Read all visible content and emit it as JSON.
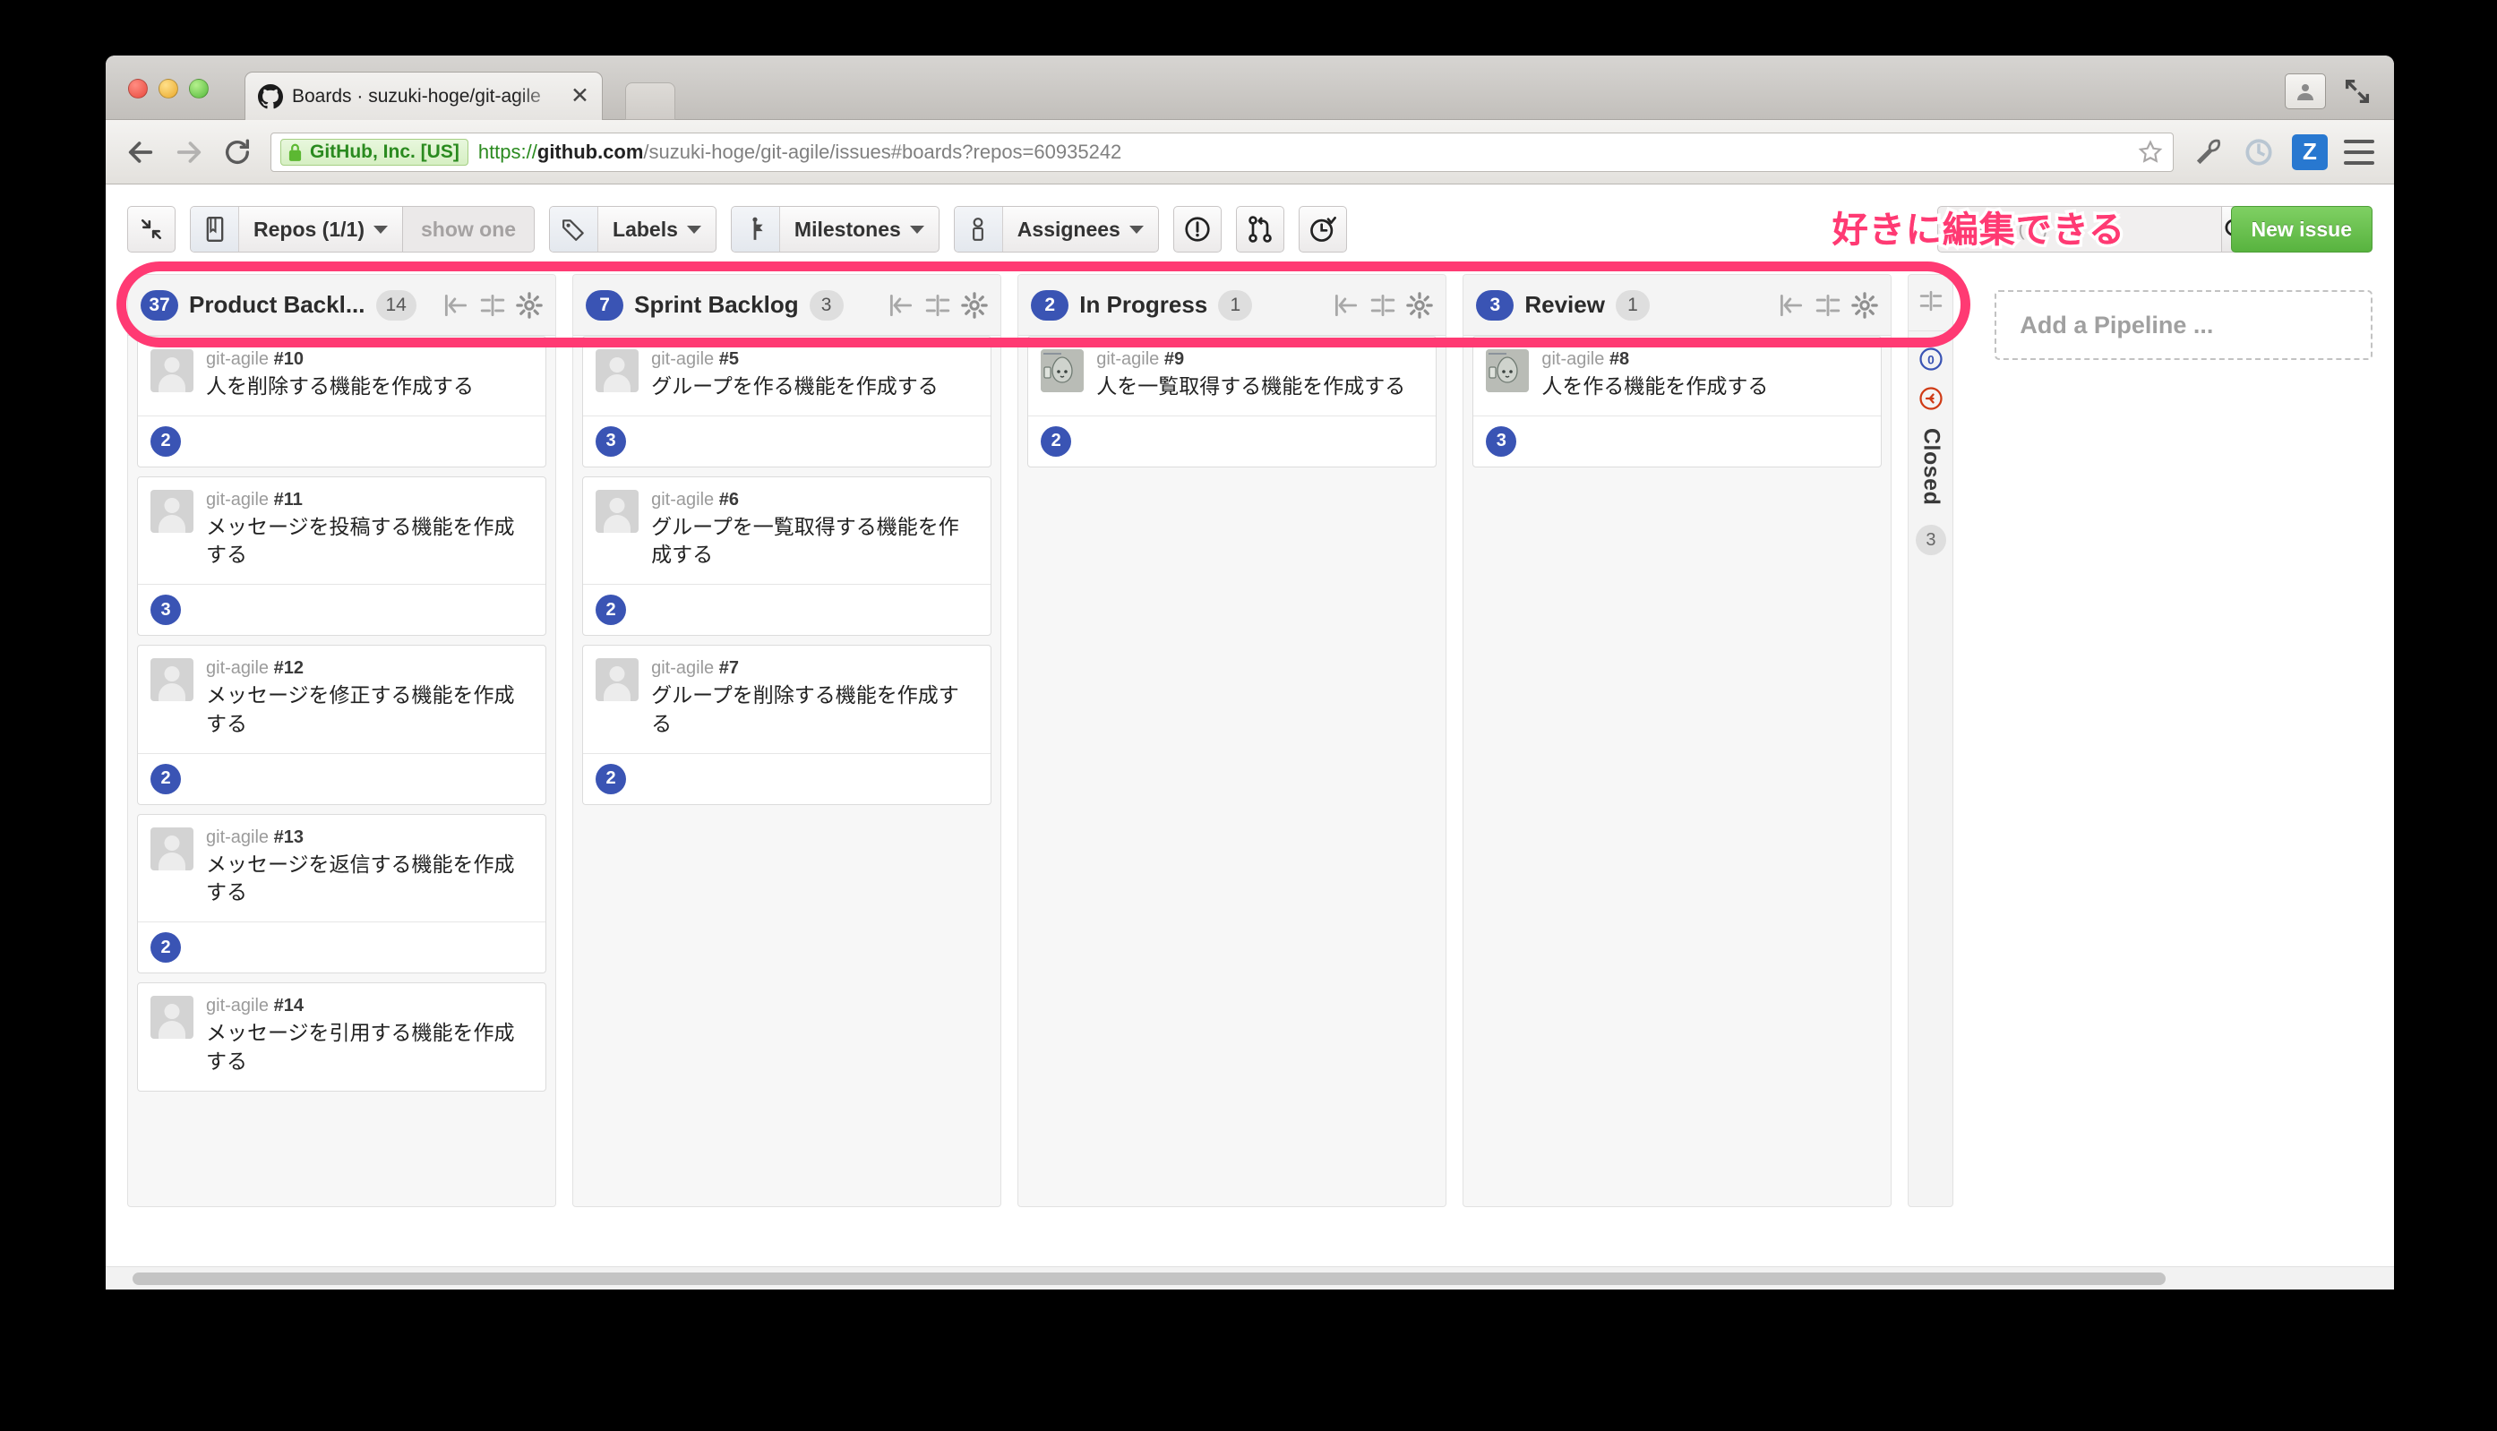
{
  "browser": {
    "tab_title": "Boards · suzuki-hoge/git-agile",
    "tab_close_label": "✕",
    "ssl_label": "GitHub, Inc. [US]",
    "url_scheme": "https://",
    "url_host": "github.com",
    "url_path": "/suzuki-hoge/git-agile/issues#boards?repos=60935242",
    "extension_badge": "Z"
  },
  "toolbar": {
    "collapse_all_label": "collapse-all",
    "repos_label": "Repos (1/1)",
    "show_one_label": "show one",
    "labels_label": "Labels",
    "milestones_label": "Milestones",
    "assignees_label": "Assignees",
    "issues_filter_label": "issues",
    "pulls_filter_label": "pull-requests",
    "recent_filter_label": "recently-updated",
    "search_placeholder": "Search ( / )",
    "new_issue_label": "New issue"
  },
  "annotation": {
    "text": "好きに編集できる",
    "color": "#ff3a73"
  },
  "board": {
    "pipelines": [
      {
        "badge": "37",
        "title": "Product Backl...",
        "count": "14",
        "cards": [
          {
            "repo": "git-agile",
            "number": "#10",
            "title": "人を削除する機能を作成する",
            "estimate": "2",
            "avatar": "placeholder"
          },
          {
            "repo": "git-agile",
            "number": "#11",
            "title": "メッセージを投稿する機能を作成する",
            "estimate": "3",
            "avatar": "placeholder"
          },
          {
            "repo": "git-agile",
            "number": "#12",
            "title": "メッセージを修正する機能を作成する",
            "estimate": "2",
            "avatar": "placeholder"
          },
          {
            "repo": "git-agile",
            "number": "#13",
            "title": "メッセージを返信する機能を作成する",
            "estimate": "2",
            "avatar": "placeholder"
          },
          {
            "repo": "git-agile",
            "number": "#14",
            "title": "メッセージを引用する機能を作成する",
            "estimate": "",
            "avatar": "placeholder"
          }
        ]
      },
      {
        "badge": "7",
        "title": "Sprint Backlog",
        "count": "3",
        "cards": [
          {
            "repo": "git-agile",
            "number": "#5",
            "title": "グループを作る機能を作成する",
            "estimate": "3",
            "avatar": "placeholder"
          },
          {
            "repo": "git-agile",
            "number": "#6",
            "title": "グループを一覧取得する機能を作成する",
            "estimate": "2",
            "avatar": "placeholder"
          },
          {
            "repo": "git-agile",
            "number": "#7",
            "title": "グループを削除する機能を作成する",
            "estimate": "2",
            "avatar": "placeholder"
          }
        ]
      },
      {
        "badge": "2",
        "title": "In Progress",
        "count": "1",
        "cards": [
          {
            "repo": "git-agile",
            "number": "#9",
            "title": "人を一覧取得する機能を作成する",
            "estimate": "2",
            "avatar": "photo"
          }
        ]
      },
      {
        "badge": "3",
        "title": "Review",
        "count": "1",
        "cards": [
          {
            "repo": "git-agile",
            "number": "#8",
            "title": "人を作る機能を作成する",
            "estimate": "3",
            "avatar": "photo"
          }
        ]
      }
    ],
    "closed_rail": {
      "issues_badge": "0",
      "label": "Closed",
      "count": "3"
    },
    "add_pipeline_label": "Add a Pipeline ..."
  }
}
